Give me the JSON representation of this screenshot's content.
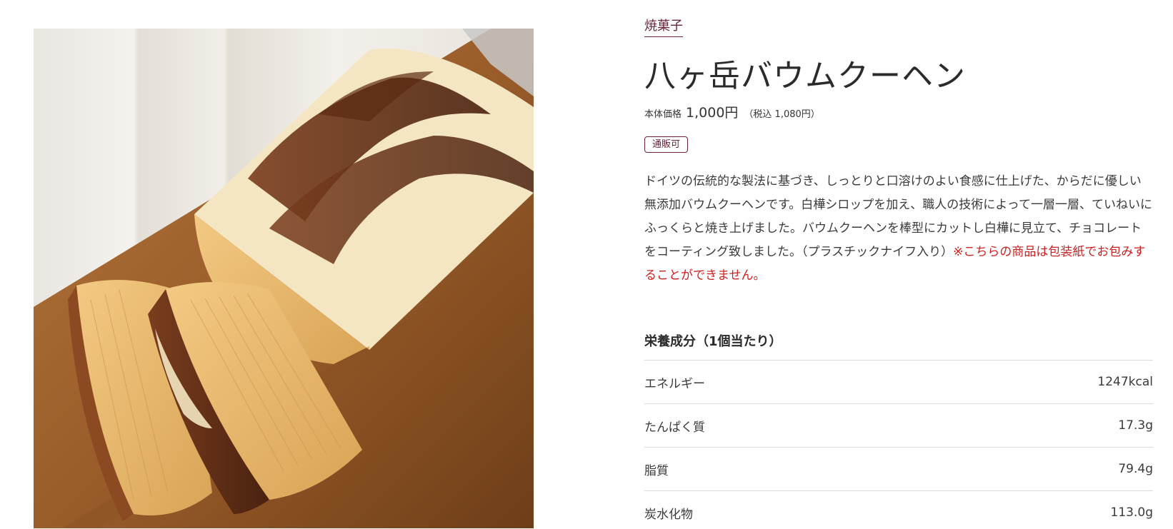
{
  "product": {
    "category": "焼菓子",
    "name": "八ヶ岳バウムクーヘン",
    "price": {
      "label": "本体価格",
      "value": "1,000円",
      "tax_included": "（税込 1,080円）"
    },
    "badge": "通販可",
    "description": "ドイツの伝統的な製法に基づき、しっとりと口溶けのよい食感に仕上げた、からだに優しい無添加バウムクーヘンです。白樺シロップを加え、職人の技術によって一層一層、ていねいにふっくらと焼き上げました。バウムクーヘンを棒型にカットし白樺に見立て、チョコレートをコーティング致しました。（プラスチックナイフ入り）",
    "notice": "※こちらの商品は包装紙でお包みすることができません。",
    "image_icon": "baumkuchen-photo"
  },
  "nutrition": {
    "title": "栄養成分（1個当たり）",
    "rows": [
      {
        "label": "エネルギー",
        "value": "1247kcal"
      },
      {
        "label": "たんぱく質",
        "value": "17.3g"
      },
      {
        "label": "脂質",
        "value": "79.4g"
      },
      {
        "label": "炭水化物",
        "value": "113.0g"
      }
    ]
  },
  "colors": {
    "accent": "#6b2437",
    "notice": "#cc1f1f",
    "text": "#333333",
    "divider": "#dcdcdc"
  }
}
